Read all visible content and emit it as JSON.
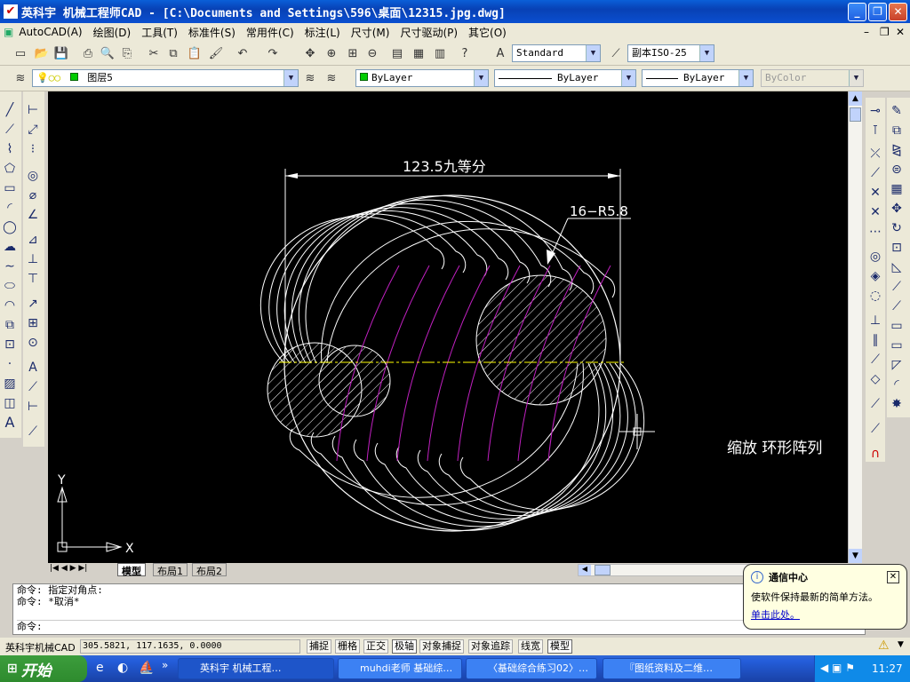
{
  "window": {
    "title": "英科宇 机械工程师CAD - [C:\\Documents and Settings\\596\\桌面\\12315.jpg.dwg]",
    "min": "_",
    "max": "❐",
    "close": "✕"
  },
  "menu": [
    "AutoCAD(A)",
    "绘图(D)",
    "工具(T)",
    "标准件(S)",
    "常用件(C)",
    "标注(L)",
    "尺寸(M)",
    "尺寸驱动(P)",
    "其它(O)"
  ],
  "mdi_buttons": [
    "–",
    "❐",
    "✕"
  ],
  "toolbar": {
    "text_style": "Standard",
    "dim_style": "副本ISO-25",
    "layer": "图层5",
    "color": "ByLayer",
    "linetype": "ByLayer",
    "lineweight": "ByLayer",
    "plotstyle": "ByColor"
  },
  "drawing": {
    "dim_top": "123.5九等分",
    "leader_label": "16−R5.8",
    "canvas_text": "缩放  环形阵列",
    "axis_x": "X",
    "axis_y": "Y",
    "colors": {
      "bg": "#000000",
      "line": "#ffffff",
      "arc": "#c020c0",
      "axis": "#ffff00"
    }
  },
  "tabs": {
    "model": "模型",
    "layout1": "布局1",
    "layout2": "布局2"
  },
  "command": {
    "line1": "命令: 指定对角点:",
    "line2": "命令: *取消*",
    "prompt": "命令:"
  },
  "status": {
    "app": "英科宇机械CAD",
    "coords": "305.5821, 117.1635, 0.0000",
    "toggles": [
      "捕捉",
      "栅格",
      "正交",
      "极轴",
      "对象捕捉",
      "对象追踪",
      "线宽",
      "模型"
    ]
  },
  "balloon": {
    "title": "通信中心",
    "body": "使软件保持最新的简单方法。",
    "link": "单击此处。"
  },
  "taskbar": {
    "start": "开始",
    "tasks": [
      "英科宇 机械工程…",
      "muhdi老师 基础综…",
      "〈基础综合练习02〉…",
      "『图纸资料及二维…"
    ],
    "clock": "11:27"
  }
}
